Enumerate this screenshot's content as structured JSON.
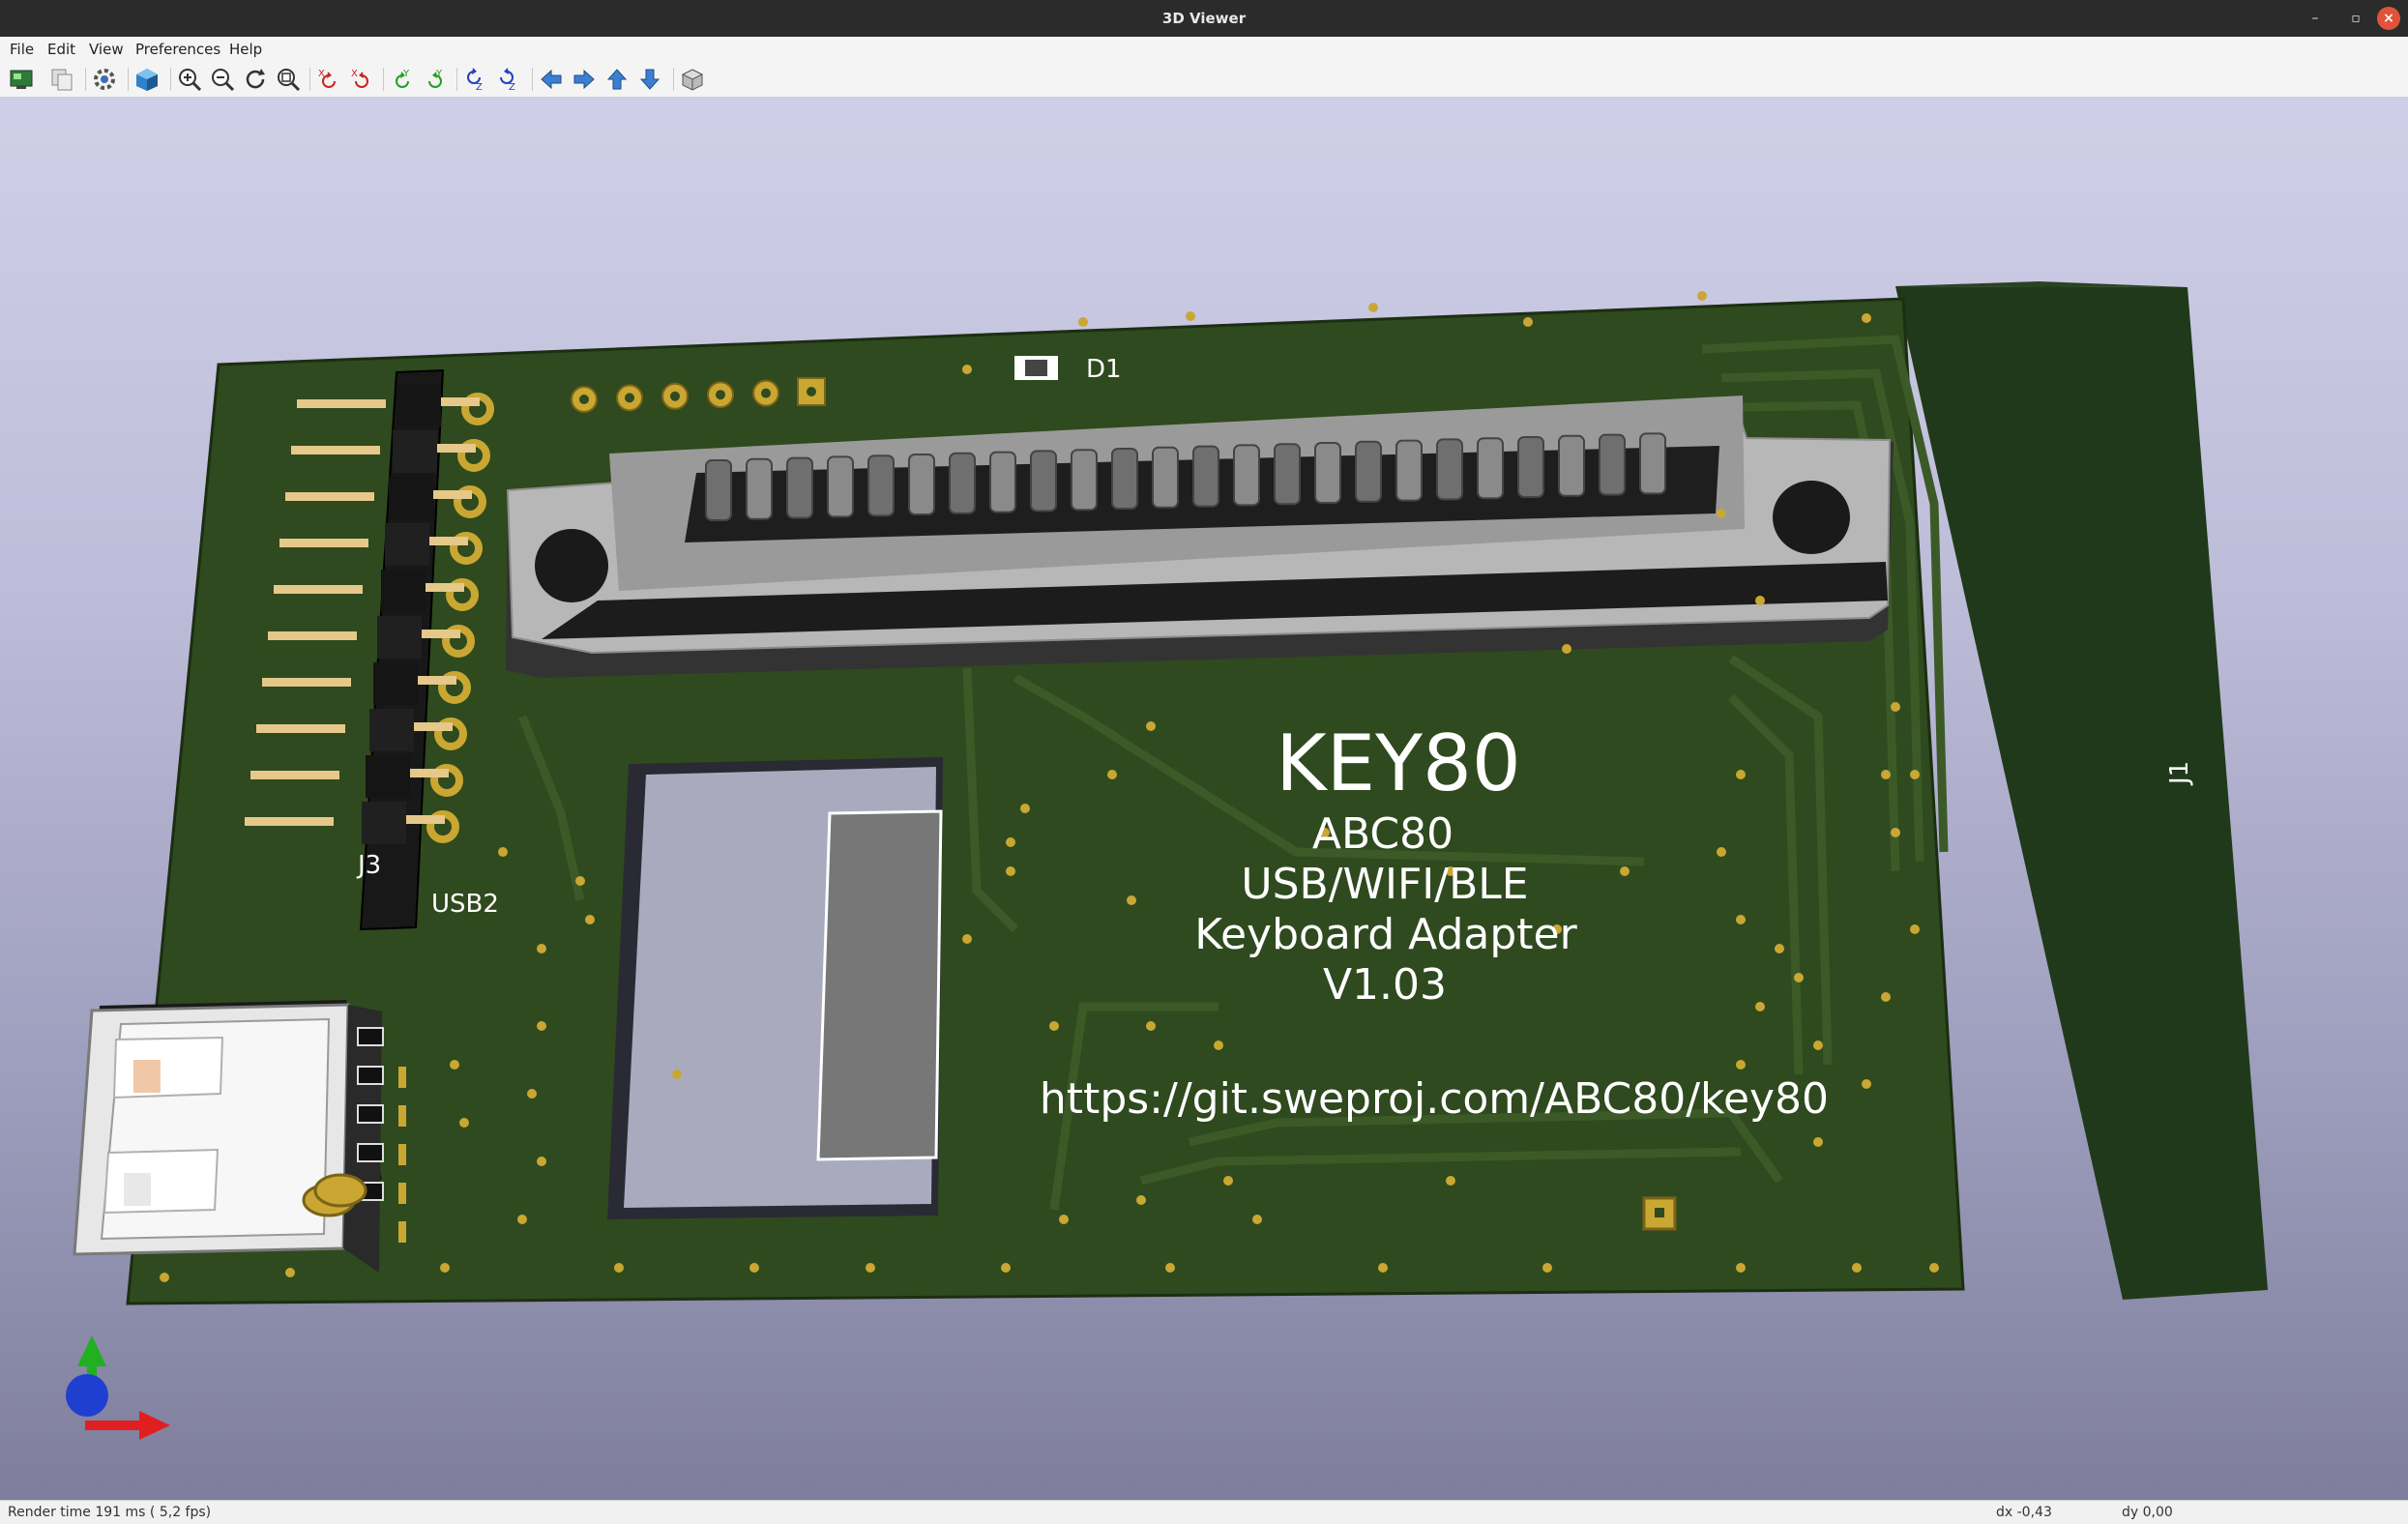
{
  "window": {
    "title": "3D Viewer"
  },
  "menu": [
    "File",
    "Edit",
    "View",
    "Preferences",
    "Help"
  ],
  "toolbar": [
    "render-raytracing-icon",
    "copy-image-icon",
    "preferences-gear-icon",
    "board-3d-cube-icon",
    "zoom-in-icon",
    "zoom-out-icon",
    "refresh-icon",
    "zoom-fit-icon",
    "rotate-x-cw-icon",
    "rotate-x-ccw-icon",
    "rotate-y-cw-icon",
    "rotate-y-ccw-icon",
    "rotate-z-cw-icon",
    "rotate-z-ccw-icon",
    "move-left-icon",
    "move-right-icon",
    "move-up-icon",
    "move-down-icon",
    "ortho-box-icon"
  ],
  "board": {
    "title": "KEY80",
    "lines": [
      "ABC80",
      "USB/WIFI/BLE",
      "Keyboard Adapter",
      "V1.03"
    ],
    "url": "https://git.sweproj.com/ABC80/key80",
    "refs": {
      "d1": "D1",
      "j3": "J3",
      "usb2": "USB2",
      "j1": "J1"
    }
  },
  "status": {
    "render": "Render time 191 ms ( 5,2 fps)",
    "dx": "dx -0,43",
    "dy": "dy 0,00"
  },
  "colors": {
    "pcb": "#2f4a1e",
    "pad": "#c9a732",
    "silk": "#ffffff",
    "axis_x": "#e02020",
    "axis_y": "#20b020",
    "axis_z": "#1f3fd0"
  }
}
